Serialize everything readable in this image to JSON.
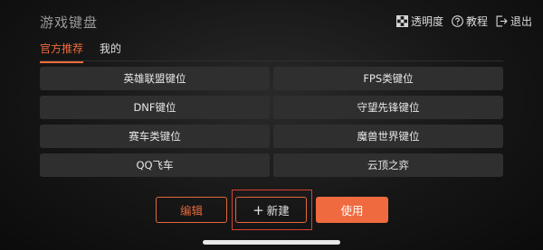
{
  "header": {
    "title": "游戏键盘",
    "actions": {
      "transparency": "透明度",
      "tutorial": "教程",
      "exit": "退出"
    }
  },
  "tabs": [
    {
      "label": "官方推荐",
      "active": true
    },
    {
      "label": "我的",
      "active": false
    }
  ],
  "presets": [
    "英雄联盟键位",
    "FPS类键位",
    "DNF键位",
    "守望先锋键位",
    "赛车类键位",
    "魔兽世界键位",
    "QQ飞车",
    "云顶之弈"
  ],
  "footer": {
    "edit_label": "编辑",
    "new_label": "新建",
    "use_label": "使用"
  },
  "colors": {
    "accent": "#ef6a3e",
    "highlight": "#d9432f",
    "button_bg": "#2f2f2f"
  }
}
